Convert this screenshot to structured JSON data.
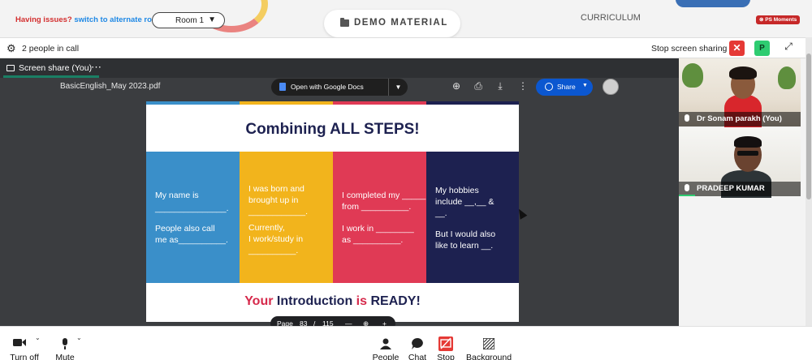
{
  "topbar": {
    "issues_text": "Having issues?",
    "switch_link": "switch to alternate room",
    "room_select": "Room 1",
    "room_arrow": "▼",
    "demo_material": "DEMO MATERIAL",
    "curriculum": "CURRICULUM",
    "ps_moments": "PS Moments"
  },
  "header": {
    "people_in_call": "2 people in call",
    "stop_sharing": "Stop screen sharing",
    "close_label": "✕",
    "p_badge": "P",
    "expand_label": "⤢"
  },
  "share": {
    "tab_label": "Screen share (You)",
    "tab_menu": "⋯",
    "pdf_name": "BasicEnglish_May 2023.pdf",
    "open_with": "Open with Google Docs",
    "dropdown": "▼",
    "share_button": "Share",
    "share_arrow": "▼",
    "page_label": "Page",
    "page_current": "83",
    "page_sep": "/",
    "page_total": "115",
    "zoom_out": "—",
    "zoom_in": "+"
  },
  "slide": {
    "title": "Combining ALL STEPS!",
    "strip_colors": [
      "#3a8fc9",
      "#f2b41c",
      "#e03a55",
      "#1d2150"
    ],
    "columns": [
      {
        "bg": "#3a8fc9",
        "lines": [
          "My name is",
          "_______________.",
          "People also call",
          "me as__________."
        ]
      },
      {
        "bg": "#f2b41c",
        "lines": [
          "I was born and",
          "brought up in",
          "____________.",
          "Currently,",
          "I work/study in",
          "__________."
        ]
      },
      {
        "bg": "#e03a55",
        "lines": [
          "I completed my _____",
          "from __________.",
          "I work in ________",
          "as __________."
        ]
      },
      {
        "bg": "#1d2150",
        "lines": [
          "My hobbies",
          "include __,__ &",
          "__.",
          "But I would also",
          "like to learn __."
        ]
      }
    ],
    "footer_your": "Your",
    "footer_intro": "Introduction",
    "footer_is": "is",
    "footer_ready": "READY!"
  },
  "participants": [
    {
      "name": "Dr Sonam parakh (You)"
    },
    {
      "name": "PRADEEP KUMAR"
    }
  ],
  "bottombar": {
    "turn_off": "Turn off",
    "mute": "Mute",
    "people": "People",
    "chat": "Chat",
    "stop": "Stop",
    "background": "Background"
  },
  "colors": {
    "accent_green": "#1a7f64",
    "stop_red": "#e53935",
    "share_blue": "#0b57d0"
  }
}
